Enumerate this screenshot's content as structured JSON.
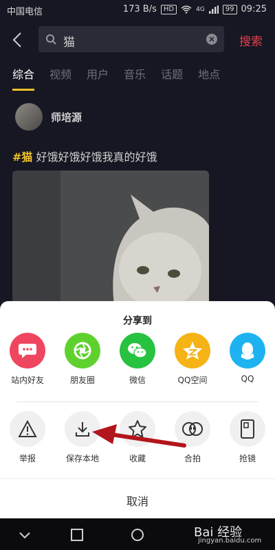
{
  "status_bar": {
    "carrier": "中国电信",
    "network_speed": "173 B/s",
    "hd": "HD",
    "signal": "4G",
    "battery": "99",
    "time": "09:25"
  },
  "search": {
    "query": "猫",
    "button_label": "搜索"
  },
  "tabs": [
    "综合",
    "视频",
    "用户",
    "音乐",
    "话题",
    "地点"
  ],
  "post": {
    "username": "师培源",
    "hashtag": "#猫",
    "text": " 好饿好饿好饿我真的好饿"
  },
  "share_sheet": {
    "title": "分享到",
    "row1": [
      {
        "label": "站内好友",
        "icon": "chat-bubble-icon",
        "color": "#f0455f"
      },
      {
        "label": "朋友圈",
        "icon": "moments-icon",
        "color": "#5fd12e"
      },
      {
        "label": "微信",
        "icon": "wechat-icon",
        "color": "#27c23f"
      },
      {
        "label": "QQ空间",
        "icon": "qzone-star-icon",
        "color": "#f6b316"
      },
      {
        "label": "QQ",
        "icon": "qq-penguin-icon",
        "color": "#1eb3f0"
      }
    ],
    "row2": [
      {
        "label": "举报",
        "icon": "warning-icon"
      },
      {
        "label": "保存本地",
        "icon": "download-icon"
      },
      {
        "label": "收藏",
        "icon": "star-icon"
      },
      {
        "label": "合拍",
        "icon": "duet-icon"
      },
      {
        "label": "抢镜",
        "icon": "phone-frame-icon"
      }
    ],
    "cancel_label": "取消",
    "neutral_circle_color": "#f0f0f0"
  },
  "annotation": {
    "arrow_color": "#b3151d"
  },
  "watermark": {
    "text": "Bai 经验",
    "sub": "jingyan.baidu.com"
  }
}
